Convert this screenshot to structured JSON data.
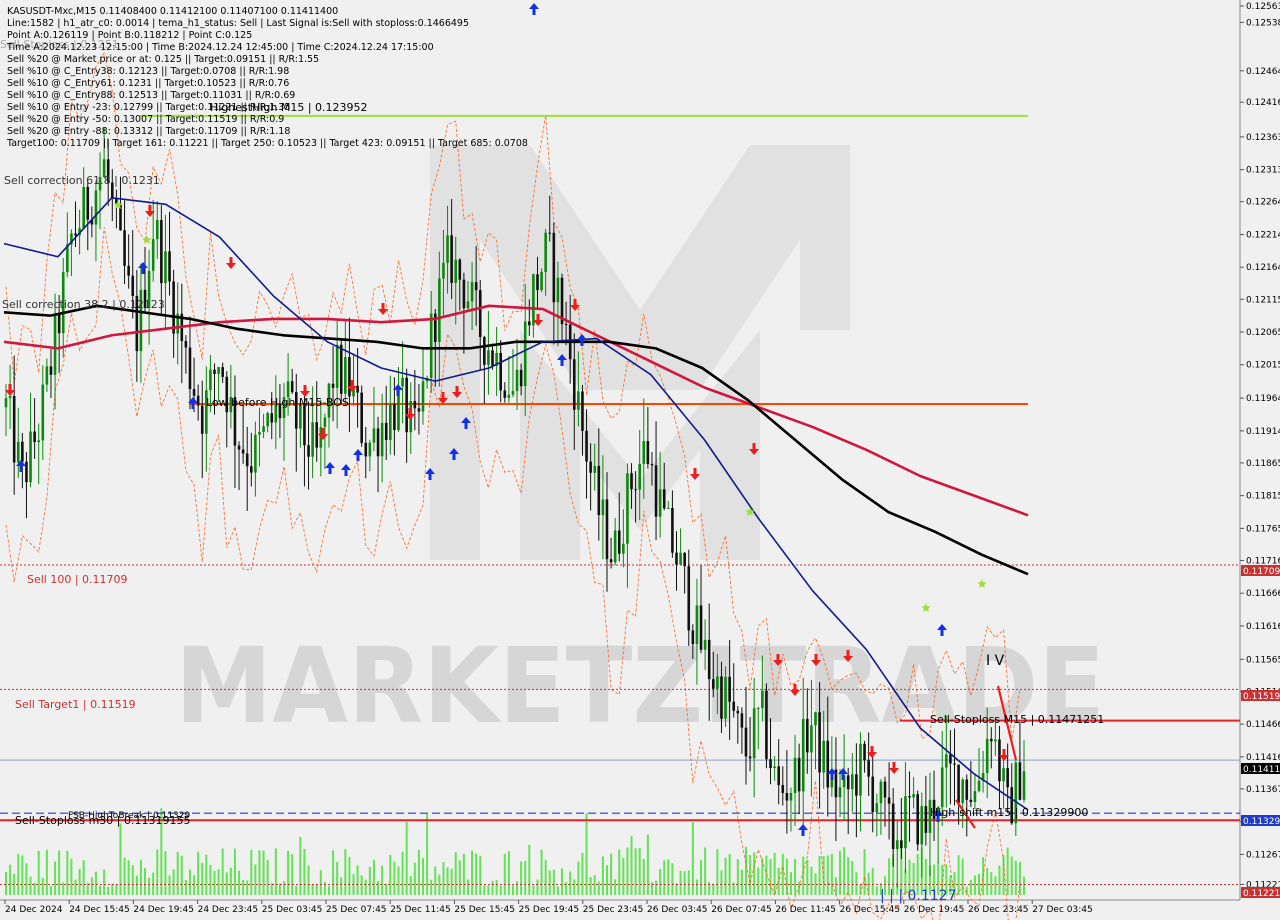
{
  "colors": {
    "background": "#f0f0f0",
    "bull_candle": "#0a8a0a",
    "bear_candle": "#111111",
    "ma_blue": "#0f1a8c",
    "ma_black": "#000000",
    "ma_red": "#d0173d",
    "level_orange": "#ff4400",
    "level_red": "#e8202a",
    "level_lime": "#9ee03a",
    "dashed_blue": "#1f3cc8",
    "dotted_red": "#c83232",
    "volume": "#33dd22",
    "band_orange": "#ff5a14",
    "watermark": "#d8d8d8"
  },
  "watermark": {
    "text": "MARKETZITRADE"
  },
  "info_lines": [
    "KASUSDT-Mxc,M15  0.11408400 0.11412100 0.11407100 0.11411400",
    "Line:1582 | h1_atr_c0: 0.0014 | tema_h1_status: Sell | Last Signal is:Sell with stoploss:0.1466495",
    "Point A:0.126119 | Point B:0.118212 | Point C:0.125",
    "Time A:2024.12.23 12:15:00 | Time B:2024.12.24 12:45:00 | Time C:2024.12.24 17:15:00",
    "Sell %20 @ Market price or at: 0.125 || Target:0.09151 || R/R:1.55",
    "Sell %10 @ C_Entry38: 0.12123 || Target:0.0708 || R/R:1.98",
    "Sell %10 @ C_Entry61: 0.1231 || Target:0.10523 || R/R:0.76",
    "Sell %10 @ C_Entry88: 0.12513 || Target:0.11031 || R/R:0.69",
    "Sell %10 @ Entry -23: 0.12799 || Target:0.11221 || R/R:1.35",
    "Sell %20 @ Entry -50: 0.13007 || Target:0.11519 || R/R:0.9",
    "Sell %20 @ Entry -88: 0.13312 || Target:0.11709 || R/R:1.18",
    "Target100: 0.11709 || Target 161: 0.11221 || Target 250: 0.10523 || Target 423: 0.09151 || Target 685: 0.0708"
  ],
  "level_labels": {
    "highest_high": "HighestHigh   M15 | 0.123952",
    "sell_correction_61": "Sell correction 61.8 | 0.1231",
    "sell_correction_38": "Sell correction 38.2 | 0.12123",
    "low_before_high": "Low before High   M15-BOS",
    "sell_100": "Sell 100 | 0.11709",
    "sell_target1": "Sell Target1 | 0.11519",
    "sell_stoploss_m15": "Sell-Stoploss M15 | 0.11471251",
    "high_shift": "High-shift m15 | 0.11329900",
    "sell_stoploss_m30": "Sell-Stoploss m30 | 0.11319155",
    "fsb_high": "FSB-HighToBreak | 0.11329",
    "bottom_label": "| | | 0.1127",
    "wave_label": "I V",
    "top_fragment": "Sell Stoploss | 0.1251"
  },
  "price_tags": {
    "t1": "0.11709",
    "t2": "0.11519",
    "t3": "0.11411",
    "t4": "0.11329",
    "t5": "0.11221"
  },
  "chart_data": {
    "type": "candlestick",
    "symbol": "KASUSDT-Mxc",
    "timeframe": "M15",
    "ylim": [
      0.11208,
      0.12563
    ],
    "y_ticks": [
      "0.12563",
      "0.12538",
      "0.12464",
      "0.12416",
      "0.12363",
      "0.12313",
      "0.12264",
      "0.12214",
      "0.12164",
      "0.12115",
      "0.12065",
      "0.12015",
      "0.11964",
      "0.11914",
      "0.11865",
      "0.11815",
      "0.11765",
      "0.11716",
      "0.11666",
      "0.11616",
      "0.11565",
      "0.11516",
      "0.11466",
      "0.11416",
      "0.11367",
      "0.11317",
      "0.11267",
      "0.11221"
    ],
    "x_ticks": [
      "24 Dec 2024",
      "24 Dec 15:45",
      "24 Dec 19:45",
      "24 Dec 23:45",
      "25 Dec 03:45",
      "25 Dec 07:45",
      "25 Dec 11:45",
      "25 Dec 15:45",
      "25 Dec 19:45",
      "25 Dec 23:45",
      "26 Dec 03:45",
      "26 Dec 07:45",
      "26 Dec 11:45",
      "26 Dec 15:45",
      "26 Dec 19:45",
      "26 Dec 23:45",
      "27 Dec 03:45"
    ],
    "close_path": [
      0.1195,
      0.1184,
      0.1192,
      0.1205,
      0.1221,
      0.1226,
      0.1232,
      0.1218,
      0.1206,
      0.1223,
      0.1213,
      0.1202,
      0.1194,
      0.1203,
      0.1191,
      0.1187,
      0.1192,
      0.1196,
      0.1191,
      0.1187,
      0.1201,
      0.1198,
      0.1189,
      0.1193,
      0.1196,
      0.119,
      0.1208,
      0.1218,
      0.1213,
      0.1206,
      0.1202,
      0.1197,
      0.1212,
      0.1219,
      0.1208,
      0.1193,
      0.118,
      0.1172,
      0.1183,
      0.1189,
      0.1178,
      0.1171,
      0.1161,
      0.1154,
      0.115,
      0.1142,
      0.1148,
      0.1136,
      0.1138,
      0.1147,
      0.1139,
      0.1135,
      0.114,
      0.1136,
      0.1129,
      0.1133,
      0.1131,
      0.1138,
      0.1139,
      0.1136,
      0.1147,
      0.1133,
      0.1141
    ],
    "ma_black": [
      0.12095,
      0.1209,
      0.12105,
      0.12095,
      0.12085,
      0.1207,
      0.1206,
      0.12055,
      0.1205,
      0.1204,
      0.1204,
      0.1205,
      0.1205,
      0.1205,
      0.1204,
      0.1201,
      0.1196,
      0.119,
      0.1184,
      0.1179,
      0.1176,
      0.11725,
      0.11695
    ],
    "ma_red": [
      0.1205,
      0.1204,
      0.1206,
      0.1207,
      0.1208,
      0.12085,
      0.12085,
      0.1208,
      0.12085,
      0.12105,
      0.121,
      0.1206,
      0.1202,
      0.1198,
      0.1195,
      0.1192,
      0.11885,
      0.11845,
      0.11815,
      0.11785
    ],
    "ma_blue": [
      0.122,
      0.1218,
      0.1227,
      0.1226,
      0.1221,
      0.1212,
      0.1205,
      0.1201,
      0.1199,
      0.1201,
      0.1205,
      0.12055,
      0.12,
      0.119,
      0.1178,
      0.1167,
      0.1158,
      0.1146,
      0.1139,
      0.11335
    ],
    "levels": [
      {
        "name": "HighestHigh",
        "value": 0.123952
      },
      {
        "name": "Low before High",
        "value": 0.11955
      },
      {
        "name": "Sell 100",
        "value": 0.11709
      },
      {
        "name": "Sell Target1",
        "value": 0.11519
      },
      {
        "name": "Sell-Stoploss M15",
        "value": 0.11471251
      },
      {
        "name": "Current price",
        "value": 0.11411
      },
      {
        "name": "High-shift m15",
        "value": 0.113299
      },
      {
        "name": "Sell-Stoploss m30",
        "value": 0.11319155
      },
      {
        "name": "Target 161",
        "value": 0.11221
      }
    ]
  }
}
